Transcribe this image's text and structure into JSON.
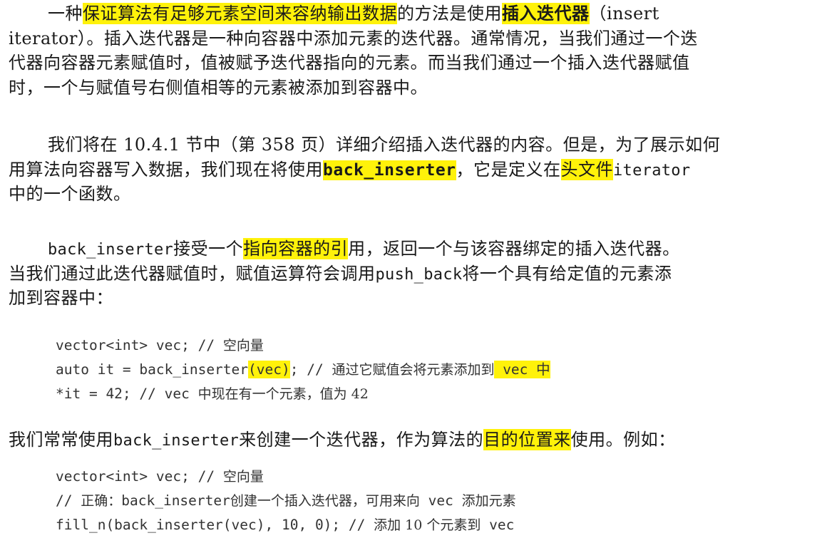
{
  "para1": {
    "l1a": "一种",
    "l1b": "保证算法有足够元素空间来容纳输出数据",
    "l1c": "的方法是使用",
    "l1d": "插入迭代器",
    "l1e": "（insert",
    "l2": "iterator）。插入迭代器是一种向容器中添加元素的迭代器。通常情况，当我们通过一个迭",
    "l3": "代器向容器元素赋值时，值被赋予迭代器指向的元素。而当我们通过一个插入迭代器赋值",
    "l4": "时，一个与赋值号右侧值相等的元素被添加到容器中。"
  },
  "para2": {
    "l1": "我们将在 10.4.1 节中（第 358 页）详细介绍插入迭代器的内容。但是，为了展示如何",
    "l2a": "用算法向容器写入数据，我们现在将使用",
    "l2b": "back_inserter",
    "l2c": "，它是定义在",
    "l2d": "头文件",
    "l2e": "iterator",
    "l3": "中的一个函数。"
  },
  "para3": {
    "l1a": "back_inserter",
    "l1b": "接受一个",
    "l1c": "指向容器的引",
    "l1d": "用，返回一个与该容器绑定的插入迭代器。",
    "l2a": "当我们通过此迭代器赋值时，赋值运算符会调用",
    "l2b": "push_back",
    "l2c": "将一个具有给定值的元素添",
    "l3": "加到容器中："
  },
  "code1": {
    "l1a": "vector<int> vec; // ",
    "l1b": "空向量",
    "l2a": "auto it = back_inserter",
    "l2b": "(vec)",
    "l2c": "; // ",
    "l2d": "通过它赋值会将元素添加到",
    "l2e": " vec 中",
    "l3a": "*it = 42; // vec ",
    "l3b": "中现在有一个元素，值为 42"
  },
  "para4": {
    "l1a": "我们常常使用",
    "l1b": "back_inserter",
    "l1c": "来创建一个迭代器，作为算法的",
    "l1d": "目的位置来",
    "l1e": "使用。例如："
  },
  "code2": {
    "l1a": "vector<int> vec; // ",
    "l1b": "空向量",
    "l2a": "// ",
    "l2b": "正确：",
    "l2c": "back_inserter",
    "l2d": "创建一个插入迭代器，可用来向",
    "l2e": " vec ",
    "l2f": "添加元素",
    "l3a": "fill_n(back_inserter(vec), 10, 0); // ",
    "l3b": "添加 10 个元素到",
    "l3c": " vec"
  },
  "colors": {
    "highlight": "#fff20a",
    "text": "#1a1a1a",
    "code": "#333333"
  }
}
